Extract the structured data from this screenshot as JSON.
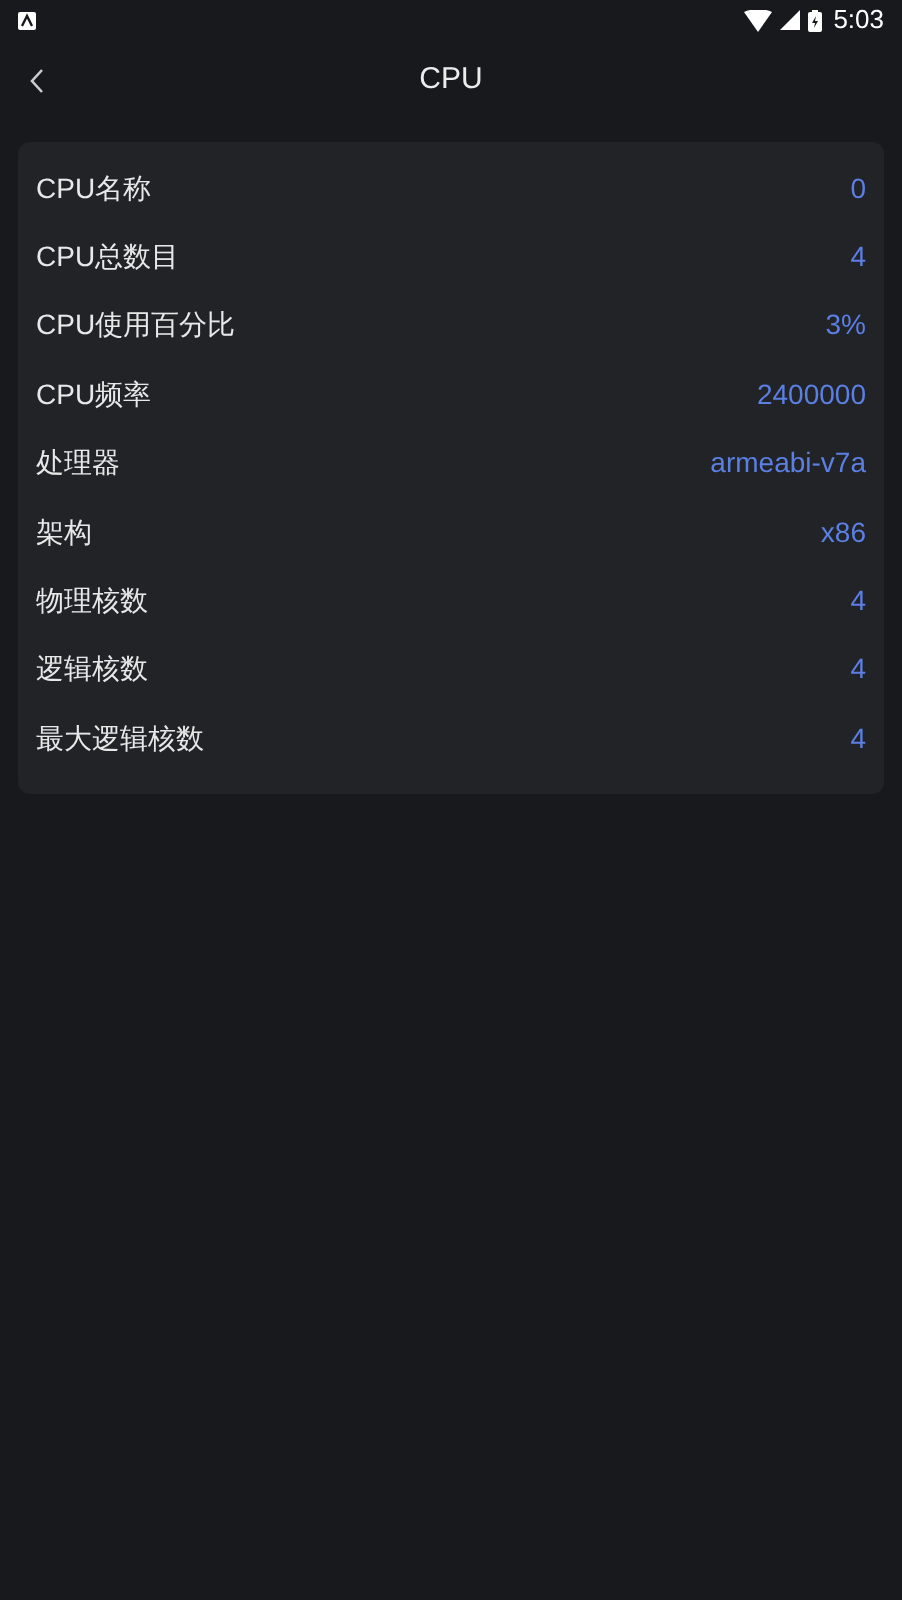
{
  "status_bar": {
    "time": "5:03"
  },
  "header": {
    "title": "CPU"
  },
  "rows": [
    {
      "label": "CPU名称",
      "value": "0"
    },
    {
      "label": "CPU总数目",
      "value": "4"
    },
    {
      "label": "CPU使用百分比",
      "value": "3%"
    },
    {
      "label": "CPU频率",
      "value": "2400000"
    },
    {
      "label": "处理器",
      "value": "armeabi-v7a"
    },
    {
      "label": "架构",
      "value": "x86"
    },
    {
      "label": "物理核数",
      "value": "4"
    },
    {
      "label": "逻辑核数",
      "value": "4"
    },
    {
      "label": "最大逻辑核数",
      "value": "4"
    }
  ]
}
